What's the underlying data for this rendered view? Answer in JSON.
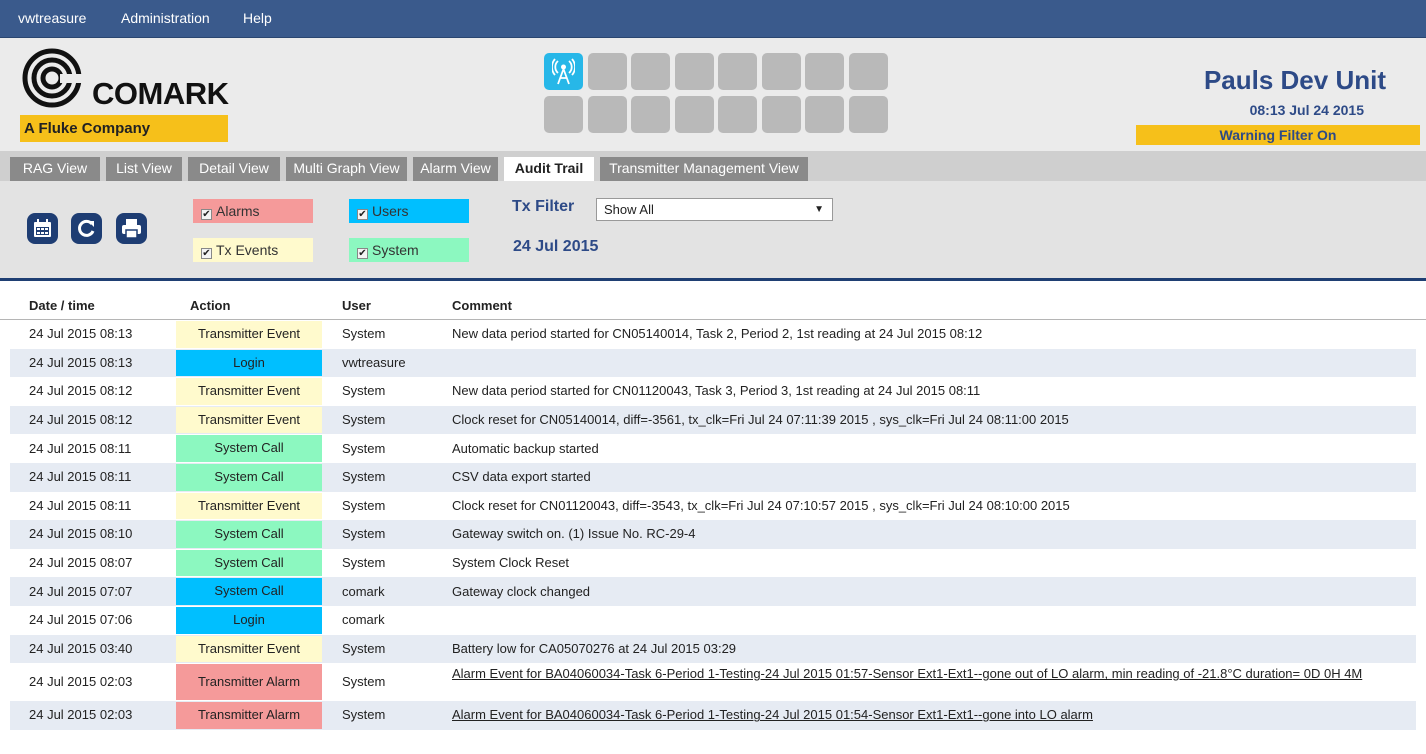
{
  "menu": [
    "vwtreasure",
    "Administration",
    "Help"
  ],
  "brand": {
    "wordmark": "COMARK",
    "tagline": "A Fluke Company"
  },
  "transmitters": {
    "slots": 16,
    "active_index": 0,
    "icon": "antenna-icon"
  },
  "unit": {
    "name": "Pauls Dev Unit",
    "time": "08:13 Jul 24 2015",
    "warning": "Warning Filter On"
  },
  "tabs": [
    {
      "label": "RAG View",
      "active": false
    },
    {
      "label": "List View",
      "active": false
    },
    {
      "label": "Detail View",
      "active": false
    },
    {
      "label": "Multi Graph View",
      "active": false
    },
    {
      "label": "Alarm View",
      "active": false
    },
    {
      "label": "Audit Trail",
      "active": true
    },
    {
      "label": "Transmitter Management View",
      "active": false
    }
  ],
  "toolbar": {
    "icons": [
      "calendar-icon",
      "refresh-icon",
      "print-icon"
    ]
  },
  "filters": {
    "alarms": "Alarms",
    "users": "Users",
    "tx_events": "Tx Events",
    "system": "System",
    "tx_filter_label": "Tx Filter",
    "tx_filter_value": "Show All",
    "date": "24 Jul 2015"
  },
  "table": {
    "headers": [
      "Date / time",
      "Action",
      "User",
      "Comment"
    ],
    "action_colors": {
      "Transmitter Event": "#fffacd",
      "Login": "#00bfff",
      "System Call": "#8cf8c0",
      "Transmitter Alarm": "#f59a9a"
    },
    "rows": [
      {
        "datetime": "24 Jul 2015 08:13",
        "action": "Transmitter Event",
        "user": "System",
        "comment": "New data period started for CN05140014, Task 2, Period 2, 1st reading at 24 Jul 2015 08:12",
        "link": false
      },
      {
        "datetime": "24 Jul 2015 08:13",
        "action": "Login",
        "user": "vwtreasure",
        "comment": "",
        "link": false
      },
      {
        "datetime": "24 Jul 2015 08:12",
        "action": "Transmitter Event",
        "user": "System",
        "comment": "New data period started for CN01120043, Task 3, Period 3, 1st reading at 24 Jul 2015 08:11",
        "link": false
      },
      {
        "datetime": "24 Jul 2015 08:12",
        "action": "Transmitter Event",
        "user": "System",
        "comment": "Clock reset for CN05140014, diff=-3561, tx_clk=Fri Jul 24 07:11:39 2015 , sys_clk=Fri Jul 24 08:11:00 2015",
        "link": false
      },
      {
        "datetime": "24 Jul 2015 08:11",
        "action": "System Call",
        "user": "System",
        "comment": "Automatic backup started",
        "link": false
      },
      {
        "datetime": "24 Jul 2015 08:11",
        "action": "System Call",
        "user": "System",
        "comment": "CSV data export started",
        "link": false
      },
      {
        "datetime": "24 Jul 2015 08:11",
        "action": "Transmitter Event",
        "user": "System",
        "comment": "Clock reset for CN01120043, diff=-3543, tx_clk=Fri Jul 24 07:10:57 2015 , sys_clk=Fri Jul 24 08:10:00 2015",
        "link": false
      },
      {
        "datetime": "24 Jul 2015 08:10",
        "action": "System Call",
        "user": "System",
        "comment": "Gateway switch on. (1) Issue No. RC-29-4",
        "link": false
      },
      {
        "datetime": "24 Jul 2015 08:07",
        "action": "System Call",
        "user": "System",
        "comment": "System Clock Reset",
        "link": false
      },
      {
        "datetime": "24 Jul 2015 07:07",
        "action": "System Call",
        "user": "comark",
        "comment": "Gateway clock changed",
        "link": false,
        "action_color_override": "Login"
      },
      {
        "datetime": "24 Jul 2015 07:06",
        "action": "Login",
        "user": "comark",
        "comment": "",
        "link": false
      },
      {
        "datetime": "24 Jul 2015 03:40",
        "action": "Transmitter Event",
        "user": "System",
        "comment": "Battery low for CA05070276 at 24 Jul 2015 03:29",
        "link": false
      },
      {
        "datetime": "24 Jul 2015 02:03",
        "action": "Transmitter Alarm",
        "user": "System",
        "comment": "Alarm Event for BA04060034-Task 6-Period 1-Testing-24 Jul 2015 01:57-Sensor Ext1-Ext1--gone out of LO alarm, min reading of -21.8°C duration= 0D 0H 4M",
        "link": true
      },
      {
        "datetime": "24 Jul 2015 02:03",
        "action": "Transmitter Alarm",
        "user": "System",
        "comment": "Alarm Event for BA04060034-Task 6-Period 1-Testing-24 Jul 2015 01:54-Sensor Ext1-Ext1--gone into LO alarm",
        "link": true
      }
    ]
  }
}
